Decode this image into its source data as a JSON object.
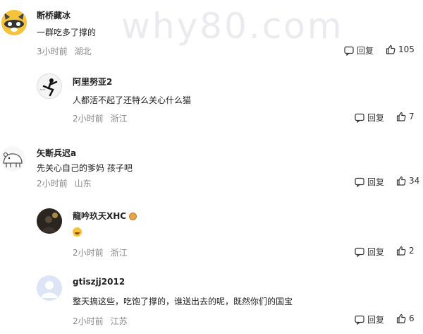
{
  "watermark": "why80.com",
  "comments": [
    {
      "user": "断桥藏冰",
      "text": "一群吃多了撑的",
      "time": "3小时前",
      "location": "湖北",
      "reply_label": "回复",
      "likes": "105"
    },
    {
      "user": "阿里努亚2",
      "text": "人都活不起了还特么关心什么猫",
      "time": "2小时前",
      "location": "浙江",
      "reply_label": "回复",
      "likes": "7"
    },
    {
      "user": "矢断兵迟a",
      "text": "先关心自己的爹妈 孩子吧",
      "time": "2小时前",
      "location": "山东",
      "reply_label": "回复",
      "likes": "34"
    },
    {
      "user": "龍吟玖天XHC",
      "text": "",
      "time": "2小时前",
      "location": "浙江",
      "reply_label": "回复",
      "likes": "2"
    },
    {
      "user": "gtiszjj2012",
      "text": "整天搞这些，吃饱了撑的，谁送出去的呢，既然你们的国宝",
      "time": "2小时前",
      "location": "江苏",
      "reply_label": "回复",
      "likes": "6"
    }
  ]
}
